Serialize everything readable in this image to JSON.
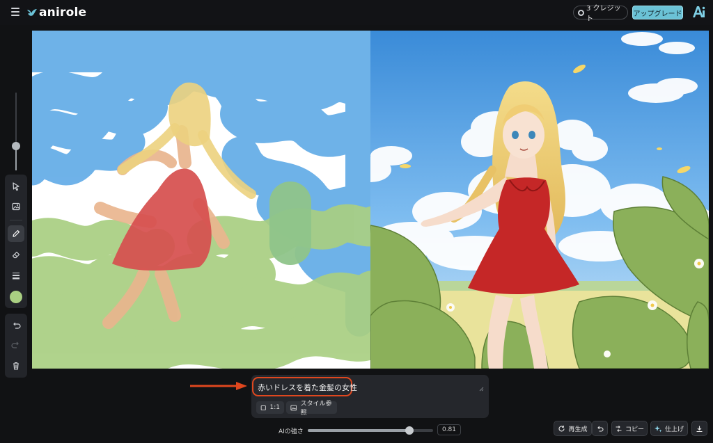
{
  "app": {
    "logo_text": "anirole",
    "credits_label": "3 クレジット",
    "upgrade_label": "アップグレード",
    "icons": {
      "menu": "hamburger-icon",
      "logo": "bird-icon",
      "ai": "ai-logo-icon"
    }
  },
  "toolbar": {
    "brush_size_level": 0.3,
    "tools": [
      {
        "name": "select",
        "icon": "cursor-icon"
      },
      {
        "name": "image",
        "icon": "image-icon"
      },
      {
        "name": "pen",
        "icon": "pencil-icon",
        "active": true
      },
      {
        "name": "eraser",
        "icon": "eraser-icon"
      },
      {
        "name": "line-width",
        "icon": "line-width-icon"
      }
    ],
    "brush_color": "#a9cf82",
    "history": [
      {
        "name": "undo",
        "icon": "undo-icon"
      },
      {
        "name": "redo",
        "icon": "redo-icon",
        "disabled": true
      },
      {
        "name": "delete",
        "icon": "trash-icon"
      }
    ]
  },
  "canvas": {
    "sketch_colors": {
      "sky": "#6ab0e8",
      "hair": "#ecd17e",
      "dress": "#d6504f",
      "skin": "#e9b58e",
      "grass": "#a9cf82"
    }
  },
  "prompt": {
    "text": "赤いドレスを着た金髪の女性",
    "aspect_ratio_label": "1:1",
    "style_ref_label": "スタイル参照",
    "highlight_color": "#e0471e"
  },
  "strength": {
    "label": "AIの強さ",
    "value": "0.81",
    "level": 0.81
  },
  "actions": {
    "regenerate_label": "再生成",
    "copy_label": "コピー",
    "finish_label": "仕上げ"
  }
}
